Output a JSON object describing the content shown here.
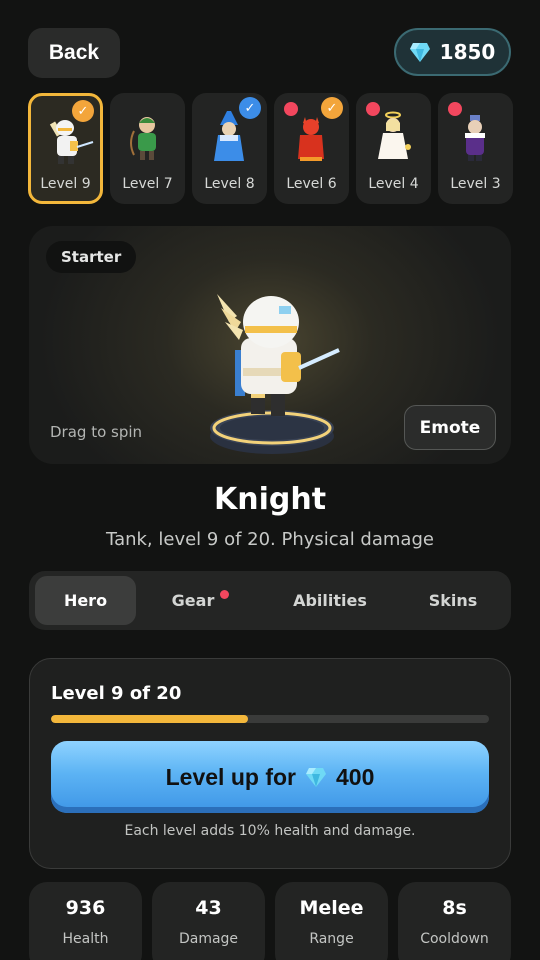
{
  "header": {
    "back_label": "Back",
    "gems": "1850",
    "gem_icon": "diamond-gem-icon",
    "gem_color": "#6fd9f5"
  },
  "heroes": [
    {
      "level": "Level 9",
      "selected": true,
      "badge": "check",
      "badge_color": "#f3a53b"
    },
    {
      "level": "Level 7",
      "selected": false,
      "badge": "none"
    },
    {
      "level": "Level 8",
      "selected": false,
      "badge": "check",
      "badge_color": "#3c8de8"
    },
    {
      "level": "Level 6",
      "selected": false,
      "badge": "check-and-dot",
      "badge_color": "#f3a53b"
    },
    {
      "level": "Level 4",
      "selected": false,
      "badge": "dot"
    },
    {
      "level": "Level 3",
      "selected": false,
      "badge": "dot"
    }
  ],
  "preview": {
    "tag": "Starter",
    "drag_hint": "Drag to spin",
    "emote_label": "Emote"
  },
  "hero": {
    "name": "Knight",
    "description": "Tank, level 9 of 20. Physical damage"
  },
  "tabs": [
    {
      "label": "Hero",
      "active": true
    },
    {
      "label": "Gear",
      "active": false,
      "notification": true
    },
    {
      "label": "Abilities",
      "active": false
    },
    {
      "label": "Skins",
      "active": false
    }
  ],
  "level_panel": {
    "title": "Level 9 of 20",
    "progress": 0.45,
    "button_prefix": "Level up for",
    "button_cost": "400",
    "note": "Each level adds 10% health and damage."
  },
  "stats": [
    {
      "value": "936",
      "label": "Health"
    },
    {
      "value": "43",
      "label": "Damage"
    },
    {
      "value": "Melee",
      "label": "Range"
    },
    {
      "value": "8s",
      "label": "Cooldown"
    }
  ],
  "colors": {
    "accent_gold": "#f3b73b",
    "accent_blue": "#5cb3f4",
    "notification_red": "#f2475e",
    "background": "#121312"
  }
}
